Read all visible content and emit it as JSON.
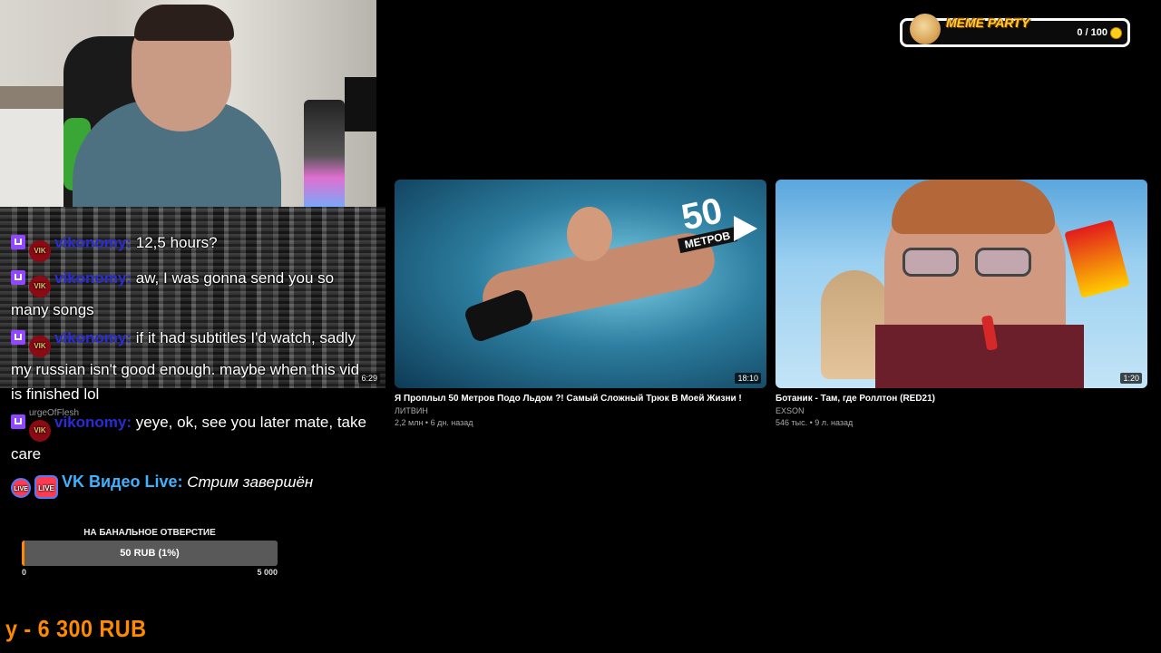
{
  "chat": {
    "messages": [
      {
        "user": "vikonomy:",
        "text": "12,5 hours?"
      },
      {
        "user": "vikonomy:",
        "text": "aw, I was gonna send you so many songs"
      },
      {
        "user": "vikonomy:",
        "text": "if it had subtitles I'd watch, sadly my russian isn't good enough. maybe when this vid is finished lol"
      },
      {
        "user": "vikonomy:",
        "text": "yeye, ok, see you later mate, take care"
      }
    ],
    "system": {
      "badge": "LIVE",
      "user": "VK Видео Live:",
      "text": "Стрим завершён"
    },
    "glitch_duration": "6:29",
    "faded_label": "urgeOfFlesh"
  },
  "goal": {
    "title": "НА БАНАЛЬНОЕ ОТВЕРСТИЕ",
    "progress_text": "50 RUB (1%)",
    "progress_fraction": 0.01,
    "min": "0",
    "max": "5 000"
  },
  "ticker": {
    "text": "y - 6 300 RUB"
  },
  "meme_party": {
    "title": "MEME PARTY",
    "count": "0 / 100"
  },
  "videos": [
    {
      "title": "Я Проплыл 50 Метров Подо Льдом ?! Самый Сложный Трюк В Моей Жизни !",
      "channel": "ЛИТВИН",
      "meta": "2,2 млн • 6 дн. назад",
      "duration": "18:10",
      "thumb_number": "50",
      "thumb_text": "МЕТРОВ"
    },
    {
      "title": "Ботаник - Там, где Роллтон (RED21)",
      "channel": "EXSON",
      "meta": "546 тыс. • 9 л. назад",
      "duration": "1:20"
    }
  ],
  "colors": {
    "accent": "#ff8a00",
    "twitch": "#9146ff",
    "vk_user": "#3db3ff",
    "chat_user": "#2b2bd6"
  }
}
